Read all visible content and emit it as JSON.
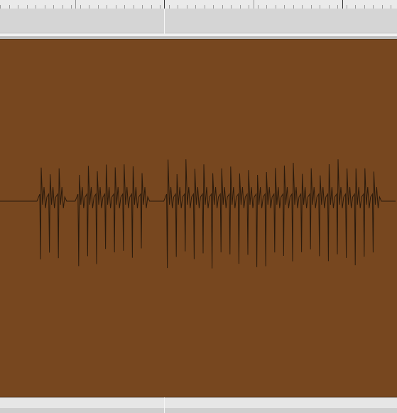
{
  "ruler": {
    "major_marker_icon": "bar-marker-icon"
  },
  "track": {
    "clip_color": "#77471f",
    "waveform_color": "#2a1a0c",
    "background_color": "#d4d4d4"
  },
  "icons": {
    "playhead": "playhead-icon"
  }
}
